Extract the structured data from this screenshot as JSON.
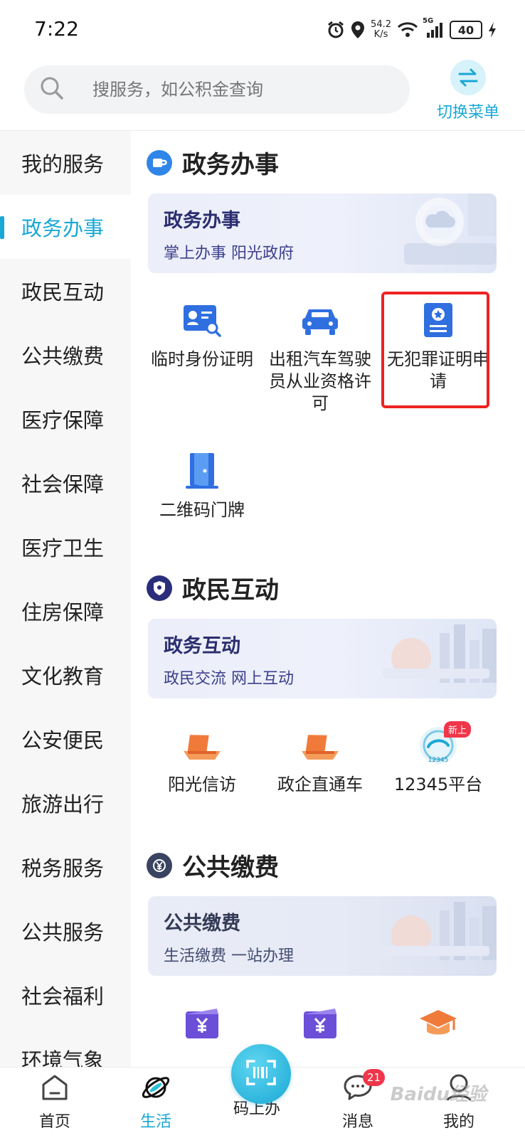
{
  "status_bar": {
    "time": "7:22",
    "net_speed_value": "54.2",
    "net_speed_unit": "K/s",
    "signal_label": "5G",
    "battery": "40"
  },
  "search": {
    "placeholder": "搜服务，如公积金查询"
  },
  "switch_menu": {
    "label": "切换菜单"
  },
  "sidebar": {
    "items": [
      {
        "label": "我的服务"
      },
      {
        "label": "政务办事"
      },
      {
        "label": "政民互动"
      },
      {
        "label": "公共缴费"
      },
      {
        "label": "医疗保障"
      },
      {
        "label": "社会保障"
      },
      {
        "label": "医疗卫生"
      },
      {
        "label": "住房保障"
      },
      {
        "label": "文化教育"
      },
      {
        "label": "公安便民"
      },
      {
        "label": "旅游出行"
      },
      {
        "label": "税务服务"
      },
      {
        "label": "公共服务"
      },
      {
        "label": "社会福利"
      },
      {
        "label": "环境气象"
      }
    ],
    "active_index": 1
  },
  "sections": {
    "gov": {
      "title": "政务办事",
      "banner_title": "政务办事",
      "banner_sub": "掌上办事 阳光政府",
      "items": [
        {
          "label": "临时身份证明",
          "icon": "id-card-search-icon"
        },
        {
          "label": "出租汽车驾驶员从业资格许可",
          "icon": "taxi-icon"
        },
        {
          "label": "无犯罪证明申请",
          "icon": "certificate-icon"
        },
        {
          "label": "二维码门牌",
          "icon": "door-icon"
        }
      ]
    },
    "interact": {
      "title": "政民互动",
      "banner_title": "政务互动",
      "banner_sub": "政民交流 网上互动",
      "items": [
        {
          "label": "阳光信访",
          "icon": "petition-icon"
        },
        {
          "label": "政企直通车",
          "icon": "enterprise-express-icon"
        },
        {
          "label": "12345平台",
          "icon": "hotline-12345-icon",
          "badge": "新上",
          "logo_text": "12345"
        }
      ]
    },
    "payment": {
      "title": "公共缴费",
      "banner_title": "公共缴费",
      "banner_sub": "生活缴费 一站办理",
      "items": [
        {
          "icon": "yuan-bill-icon"
        },
        {
          "icon": "yuan-bill-icon"
        },
        {
          "icon": "graduation-cap-icon"
        }
      ]
    }
  },
  "bottom_nav": {
    "items": [
      {
        "label": "首页",
        "icon": "home-icon"
      },
      {
        "label": "生活",
        "icon": "planet-icon"
      },
      {
        "label": "码上办",
        "icon": "scan-code-icon"
      },
      {
        "label": "消息",
        "icon": "chat-icon",
        "badge": "21"
      },
      {
        "label": "我的",
        "icon": "profile-icon"
      }
    ],
    "active_index": 1
  },
  "watermark": "Baidu经验",
  "colors": {
    "accent": "#1aa8d6",
    "highlight": "#ee2222",
    "badge": "#f0364a",
    "icon_blue": "#2f6fe0",
    "icon_orange": "#f07a3a",
    "icon_purple": "#6b4fd8"
  }
}
